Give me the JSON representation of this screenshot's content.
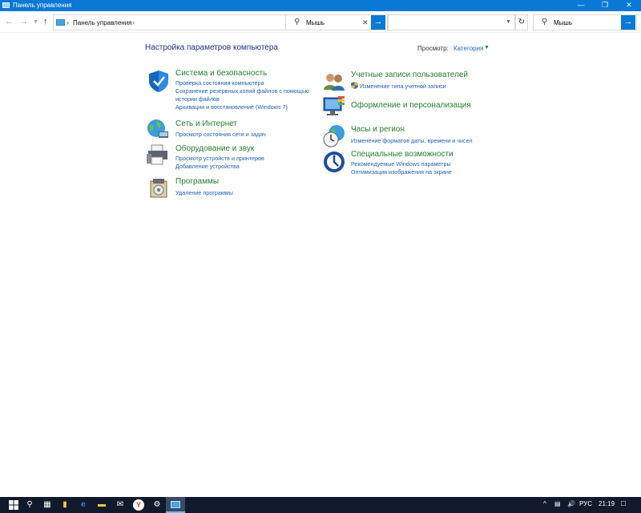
{
  "window": {
    "title": "Панель управления"
  },
  "nav": {
    "breadcrumb": "Панель управления",
    "search_mid_value": "Мышь",
    "search_right_value": "Мышь"
  },
  "main": {
    "heading": "Настройка параметров компьютера",
    "view_label": "Просмотр:",
    "view_value": "Категория"
  },
  "categories": [
    {
      "title": "Система и безопасность",
      "links": [
        "Проверка состояния компьютера",
        "Сохранение резервных копий файлов с помощью",
        "истории файлов",
        "Архивация и восстановление (Windows 7)"
      ]
    },
    {
      "title": "Сеть и Интернет",
      "links": [
        "Просмотр состояния сети и задач"
      ]
    },
    {
      "title": "Оборудование и звук",
      "links": [
        "Просмотр устройств и принтеров",
        "Добавление устройства"
      ]
    },
    {
      "title": "Программы",
      "links": [
        "Удаление программы"
      ]
    },
    {
      "title": "Учетные записи пользователей",
      "links": [
        "Изменение типа учетной записи"
      ]
    },
    {
      "title": "Оформление и персонализация",
      "links": []
    },
    {
      "title": "Часы и регион",
      "links": [
        "Изменение форматов даты, времени и чисел"
      ]
    },
    {
      "title": "Специальные возможности",
      "links": [
        "Рекомендуемые Windows параметры",
        "Оптимизация изображения на экране"
      ]
    }
  ],
  "taskbar": {
    "language": "РУС",
    "time": "21:19"
  },
  "colors": {
    "accent": "#0a79d6",
    "category_title": "#24802c",
    "link": "#1f63b2",
    "heading": "#1e3287",
    "taskbar": "#111a2c"
  }
}
